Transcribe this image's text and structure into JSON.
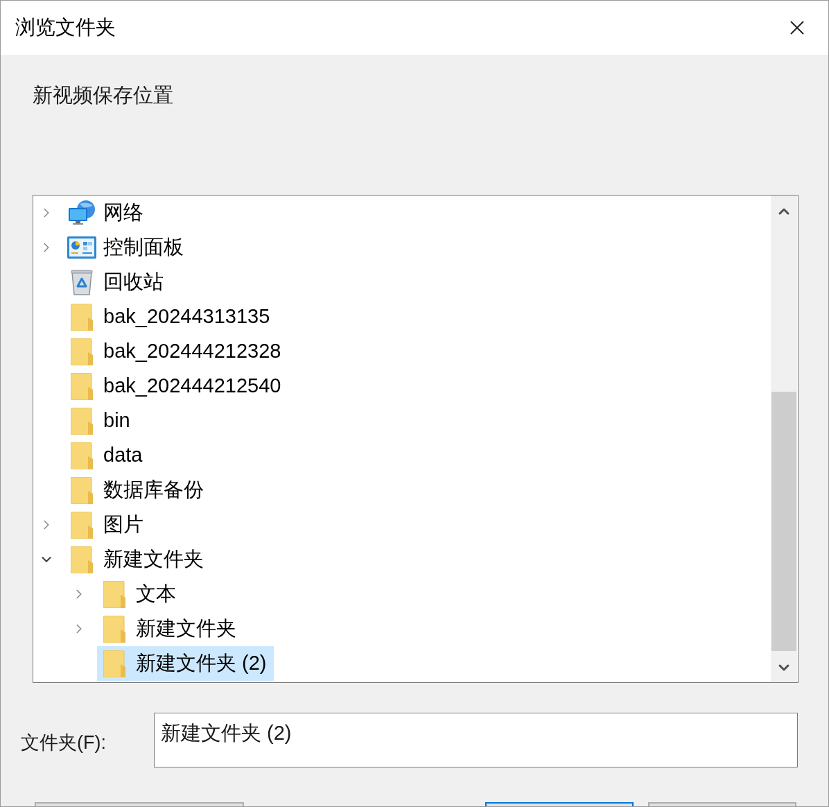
{
  "window": {
    "title": "浏览文件夹"
  },
  "description": "新视频保存位置",
  "tree": {
    "items": [
      {
        "label": "网络",
        "kind": "network",
        "expanded": false,
        "selected": false
      },
      {
        "label": "控制面板",
        "kind": "control_panel",
        "expanded": false,
        "selected": false
      },
      {
        "label": "回收站",
        "kind": "recycle_bin",
        "selected": false
      },
      {
        "label": "bak_20244313135",
        "kind": "folder",
        "selected": false
      },
      {
        "label": "bak_202444212328",
        "kind": "folder",
        "selected": false
      },
      {
        "label": "bak_202444212540",
        "kind": "folder",
        "selected": false
      },
      {
        "label": "bin",
        "kind": "folder",
        "selected": false
      },
      {
        "label": "data",
        "kind": "folder",
        "selected": false
      },
      {
        "label": "数据库备份",
        "kind": "folder",
        "selected": false
      },
      {
        "label": "图片",
        "kind": "folder",
        "expanded": false,
        "selected": false
      },
      {
        "label": "新建文件夹",
        "kind": "folder",
        "expanded": true,
        "selected": false,
        "children": [
          {
            "label": "文本",
            "kind": "folder",
            "expanded": false,
            "selected": false
          },
          {
            "label": "新建文件夹",
            "kind": "folder",
            "expanded": false,
            "selected": false
          },
          {
            "label": "新建文件夹 (2)",
            "kind": "folder",
            "selected": true
          }
        ]
      }
    ]
  },
  "folder_field": {
    "label": "文件夹(F):",
    "value": "新建文件夹 (2)"
  },
  "buttons": [
    {
      "default": false
    },
    {
      "default": true
    },
    {
      "default": false
    }
  ]
}
